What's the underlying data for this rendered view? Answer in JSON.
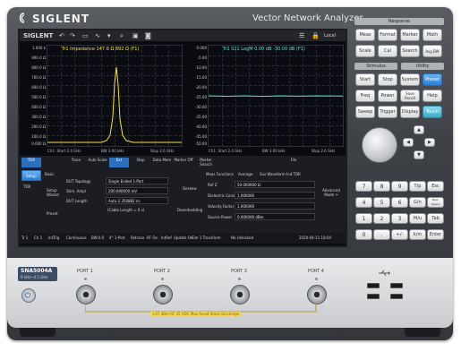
{
  "brand": "SIGLENT",
  "product": "Vector Network Analyzer",
  "model": "SNA5004A",
  "freq_range": "9 kHz~4.5 GHz",
  "screen": {
    "toolbar": [
      "SIGLENT",
      "Local"
    ],
    "left_plot": {
      "title": "Tr1 Impedance 147.6 Ω 892 Ω (F1)",
      "color": "#f4e04a",
      "y_ticks": [
        "1.000 k",
        "900.0 Ω",
        "800.0 Ω",
        "700.0 Ω",
        "600.0 Ω",
        "500.0 Ω",
        "400.0 Ω",
        "300.0 Ω",
        "200.0 Ω",
        "100.0 Ω",
        "0.000 Ω"
      ],
      "footer_left": "Ch1: Start 2.4 GHz",
      "footer_mid": "BW 3.00 kHz",
      "footer_right": "Stop 2.6 GHz"
    },
    "right_plot": {
      "title": "Tr2 S11 LogM 0.00 dB -30.00 dB (F1)",
      "color": "#5ce6c6",
      "y_ticks": [
        "0.000",
        "-5.00",
        "-10.00",
        "-15.00",
        "-20.00",
        "-25.00",
        "-30.00",
        "-35.00",
        "-40.00",
        "-45.00",
        "-50.00"
      ],
      "footer_left": "Ch1: Start 2.4 GHz",
      "footer_mid": "BW 3.00 kHz",
      "footer_right": "Stop 2.6 GHz"
    },
    "tabs": [
      "TDR",
      "Trace",
      "Auto Scale",
      "Ext",
      "Step",
      "Data Mem",
      "Marker Off",
      "Marker Search",
      "File"
    ],
    "sidebar": [
      "Setup",
      "Basic",
      "TDR"
    ],
    "fields_left": [
      {
        "label": "DUT Topology",
        "value": "Single Ended 1-Port"
      },
      {
        "label": "Stim. Ampl",
        "value": "200.000000 mV"
      },
      {
        "label": "DUT Length",
        "value": "Auto  2.350882 ns"
      },
      {
        "label": "",
        "value": "(Cable Length = 0 s)"
      }
    ],
    "menu_buttons": [
      "Setup Wizard",
      "Deskew",
      "Preset",
      "Deembedding"
    ],
    "fields_right_head": [
      "Meas Functions",
      "Average",
      "Sus Waveform",
      "Ind TDR"
    ],
    "fields_right": [
      {
        "label": "Ref Z",
        "value": "50.000000 Ω"
      },
      {
        "label": "Dielectric Const.",
        "value": "1.000000"
      },
      {
        "label": "Velocity Factor",
        "value": "1.000000"
      },
      {
        "label": "Source Power",
        "value": "0.000000 dBm"
      }
    ],
    "advanced": "Advanced Mode >",
    "status": [
      "Tr 1",
      "Ch 1",
      "IntTrig",
      "Continuous",
      "BW:4.0",
      "4° 1-Port",
      "Retrace",
      "RF On",
      "IntRef",
      "Update On",
      "Sim 1 Transform",
      "No Unlocked",
      "2020-04-11 18:04"
    ]
  },
  "keys": {
    "response_head": "Response",
    "response": [
      "Meas",
      "Format",
      "Marker",
      "Math",
      "Scale",
      "Cal",
      "Search",
      "Avg BW"
    ],
    "stimulus_head": "Stimulus",
    "utility_head": "Utility",
    "stimulus": [
      "Start",
      "Stop",
      "Freq",
      "Power",
      "Sweep",
      "Trigger"
    ],
    "utility": [
      "System",
      "Preset",
      "Save Recall",
      "Help",
      "Display",
      "Touch"
    ],
    "numpad": [
      "7",
      "8",
      "9",
      "T/p",
      "Esc",
      "4",
      "5",
      "6",
      "G/n",
      "Back Space",
      "1",
      "2",
      "3",
      "M/u",
      "Tab",
      "0",
      ".",
      "+/-",
      "k/m",
      "Enter"
    ]
  },
  "ports": [
    "PORT 1",
    "PORT 2",
    "PORT 3",
    "PORT 4"
  ],
  "warning": "+27 dBm RF  35 VDC Max    Avoid Static Discharge"
}
